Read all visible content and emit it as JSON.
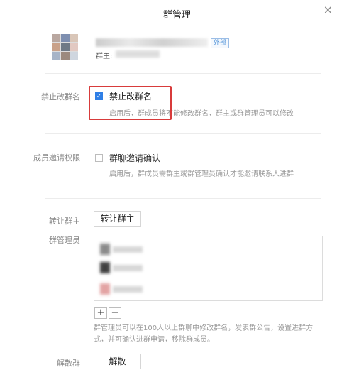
{
  "window": {
    "title": "群管理",
    "close_glyph": "×"
  },
  "group": {
    "external_badge": "外部",
    "owner_label": "群主:"
  },
  "rename": {
    "label": "禁止改群名",
    "option": "禁止改群名",
    "checked": true,
    "description": "启用后，群成员将不能修改群名，群主或群管理员可以修改"
  },
  "invite": {
    "label": "成员邀请权限",
    "option": "群聊邀请确认",
    "checked": false,
    "description": "启用后，群成员需群主或群管理员确认才能邀请联系人进群"
  },
  "transfer": {
    "label": "转让群主",
    "button": "转让群主"
  },
  "admins": {
    "label": "群管理员",
    "add_glyph": "+",
    "remove_glyph": "−",
    "note": "群管理员可以在100人以上群聊中修改群名，发表群公告，设置进群方式，并可确认进群申请，移除群成员。"
  },
  "dissolve": {
    "label": "解散群",
    "button": "解散"
  },
  "colors": {
    "accent": "#2f7fe6",
    "highlight": "#d83b3b"
  }
}
